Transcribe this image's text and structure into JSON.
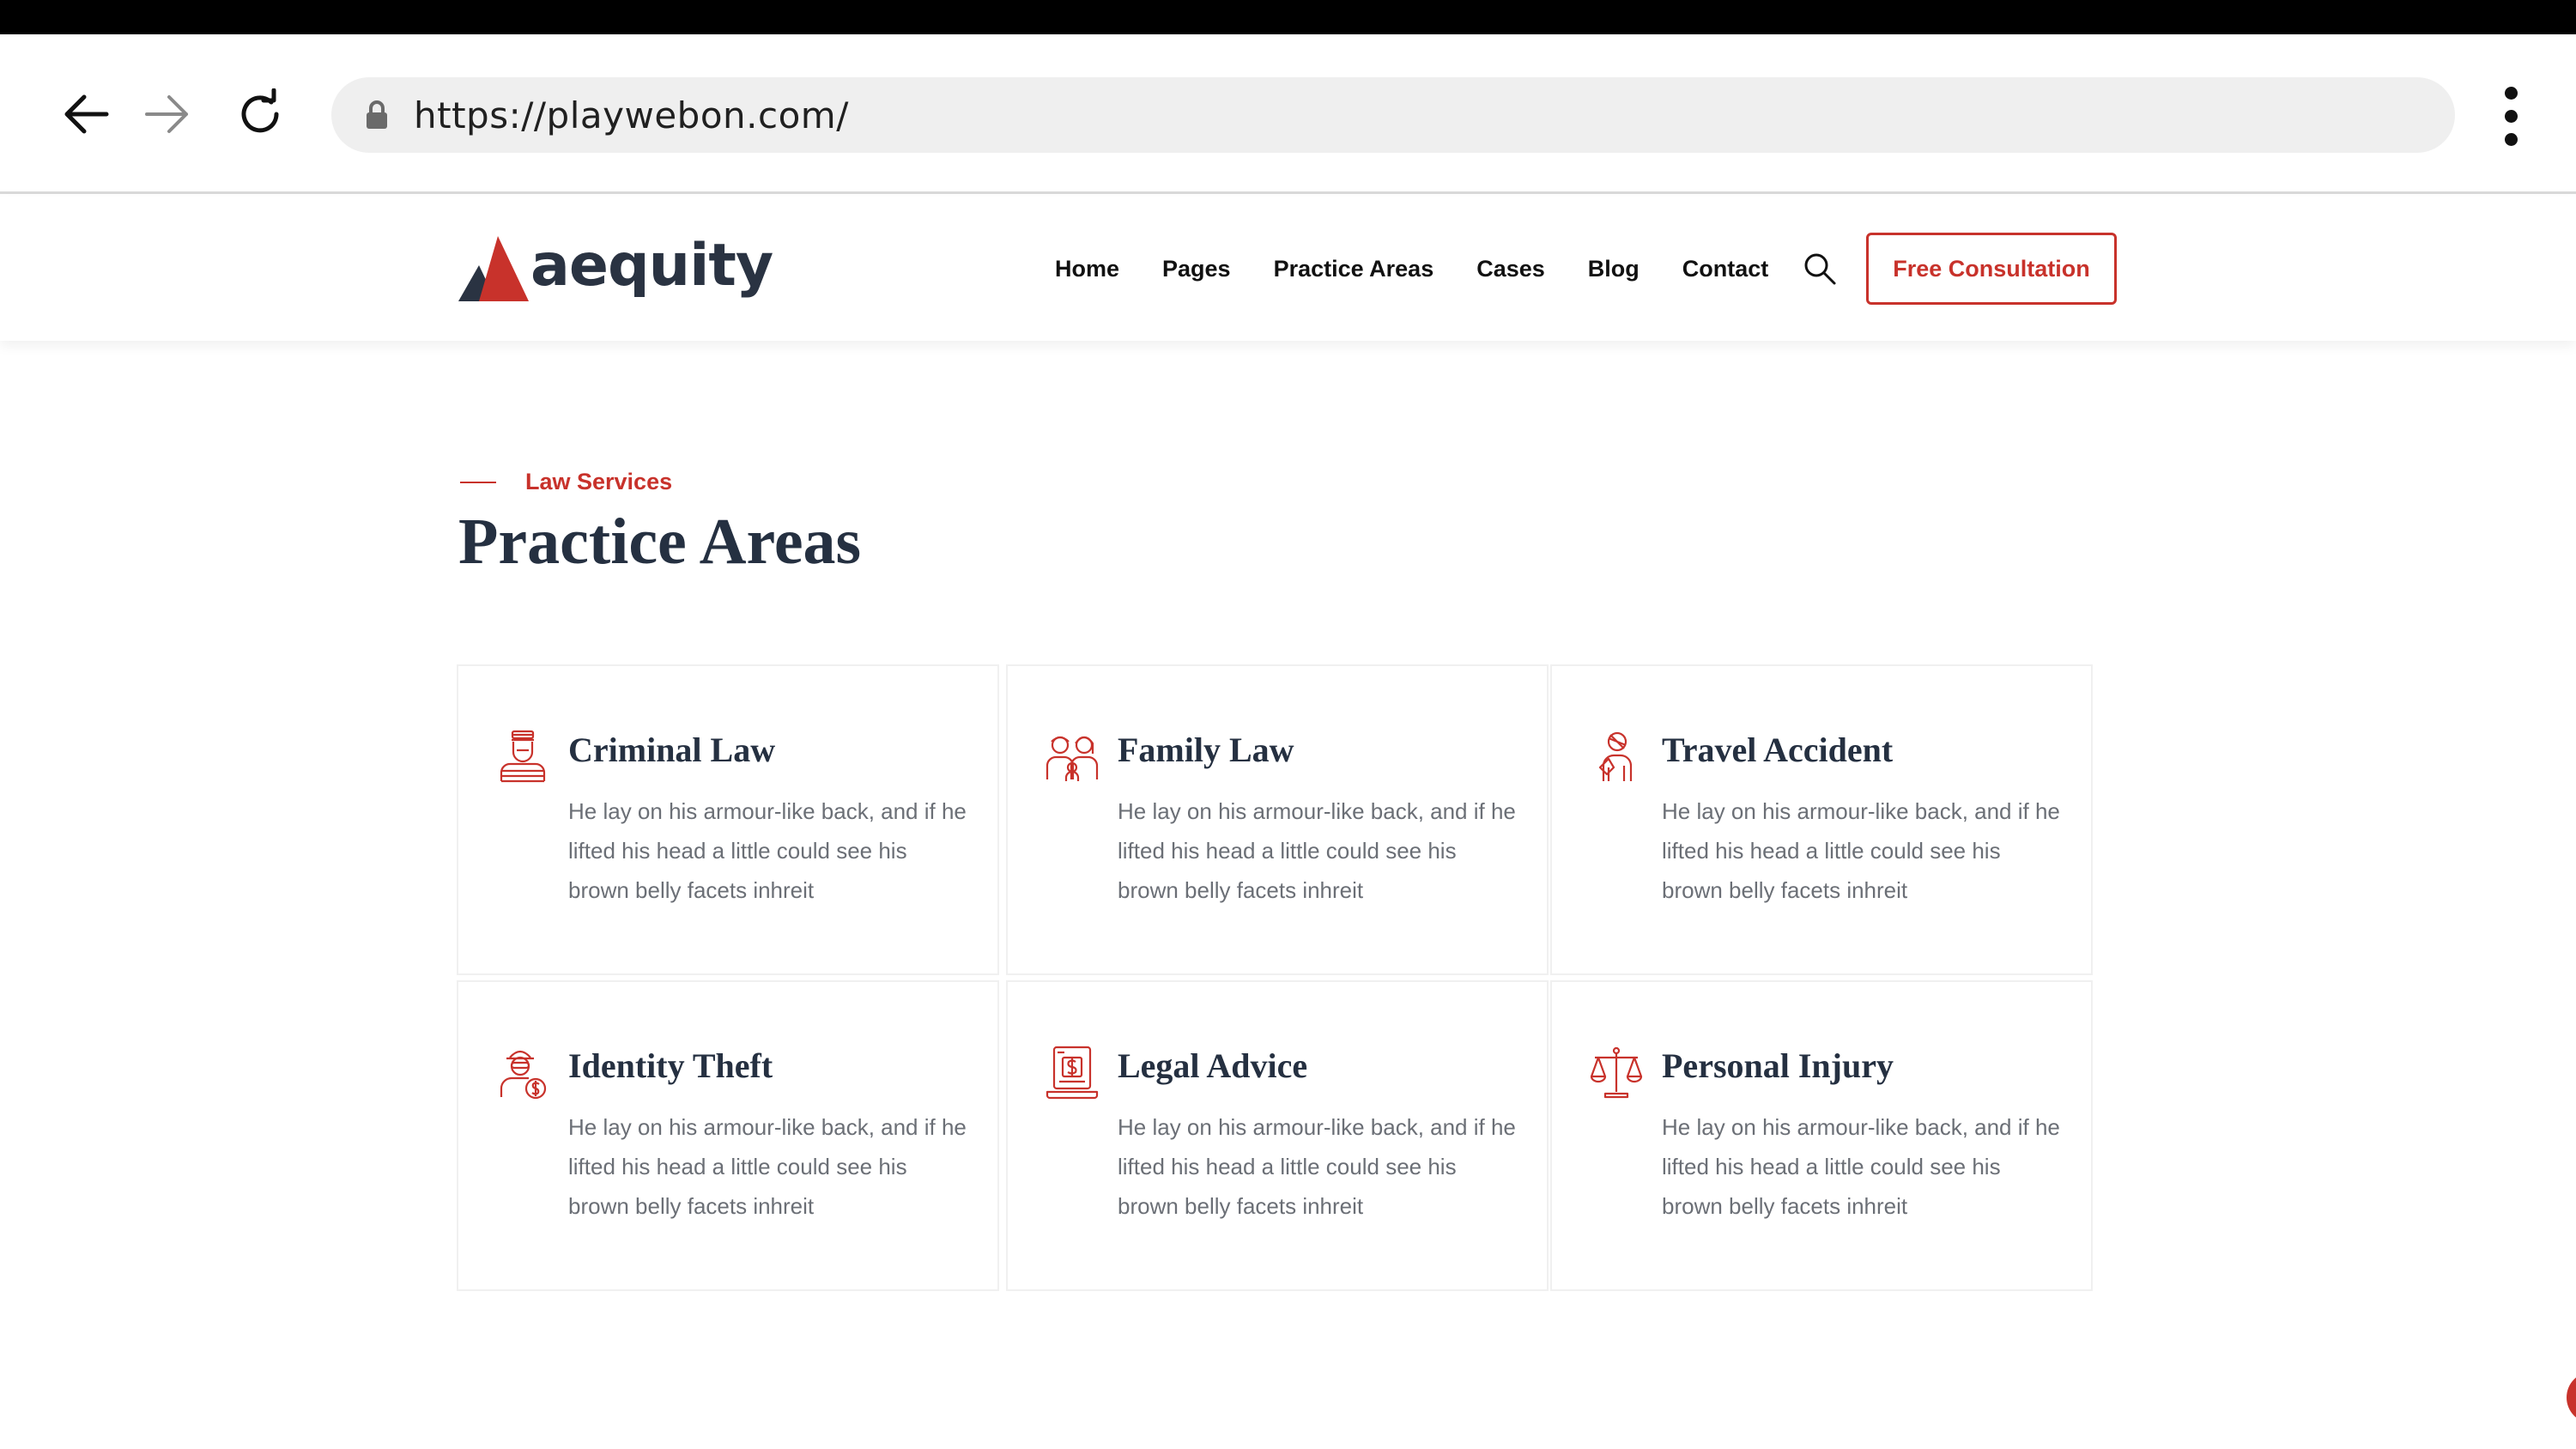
{
  "browser": {
    "url": "https://playwebon.com/"
  },
  "header": {
    "logo_text": "aequity",
    "nav": [
      "Home",
      "Pages",
      "Practice Areas",
      "Cases",
      "Blog",
      "Contact"
    ],
    "cta_label": "Free Consultation"
  },
  "section": {
    "eyebrow": "Law Services",
    "title": "Practice Areas"
  },
  "cards": [
    {
      "title": "Criminal Law",
      "icon": "prisoner-icon",
      "text": "He lay on his armour-like back, and if he lifted his head a little could see his brown belly facets inhreit"
    },
    {
      "title": "Family Law",
      "icon": "family-icon",
      "text": "He lay on his armour-like back, and if he lifted his head a little could see his brown belly facets inhreit"
    },
    {
      "title": "Travel Accident",
      "icon": "injured-person-icon",
      "text": "He lay on his armour-like back, and if he lifted his head a little could see his brown belly facets inhreit"
    },
    {
      "title": "Identity Theft",
      "icon": "thief-icon",
      "text": "He lay on his armour-like back, and if he lifted his head a little could see his brown belly facets inhreit"
    },
    {
      "title": "Legal Advice",
      "icon": "laptop-dollar-icon",
      "text": "He lay on his armour-like back, and if he lifted his head a little could see his brown belly facets inhreit"
    },
    {
      "title": "Personal Injury",
      "icon": "scales-icon",
      "text": "He lay on his armour-like back, and if he lifted his head a little could see his brown belly facets inhreit"
    }
  ],
  "colors": {
    "accent": "#c8322b",
    "heading": "#253041",
    "body_text": "#6b6f76"
  }
}
